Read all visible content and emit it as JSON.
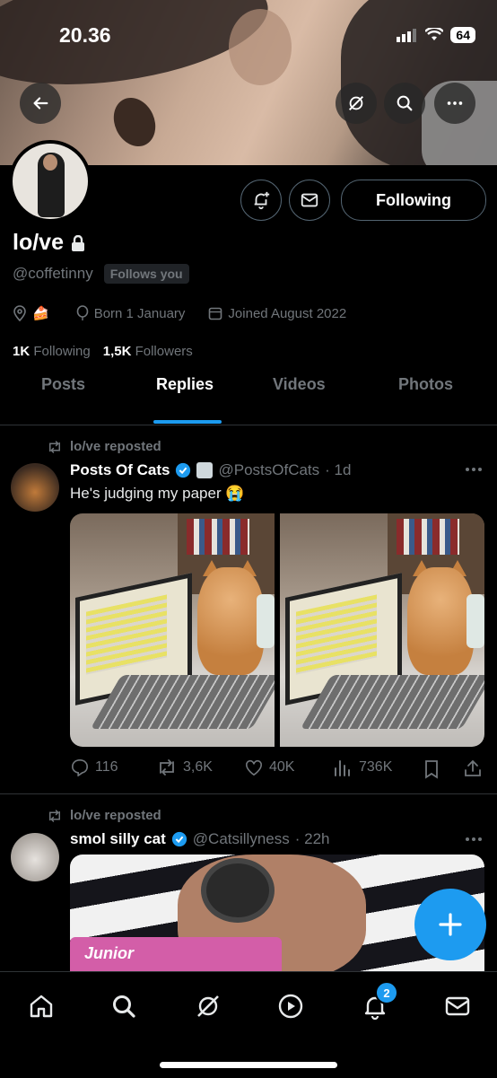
{
  "status_bar": {
    "time": "20.36",
    "battery": "64"
  },
  "profile": {
    "display_name": "lo/ve",
    "handle": "@coffetinny",
    "follows_you": "Follows you",
    "location_emoji": "🍰",
    "born": "Born 1 January",
    "joined": "Joined August 2022",
    "following_count": "1K",
    "following_label": "Following",
    "followers_count": "1,5K",
    "followers_label": "Followers",
    "follow_button": "Following"
  },
  "tabs": [
    {
      "label": "Posts"
    },
    {
      "label": "Replies"
    },
    {
      "label": "Videos"
    },
    {
      "label": "Photos"
    }
  ],
  "active_tab": "Replies",
  "posts": [
    {
      "repost_label": "lo/ve reposted",
      "author": "Posts Of Cats",
      "handle": "@PostsOfCats",
      "time": "· 1d",
      "text": "He's judging my paper 😭",
      "replies": "116",
      "reposts": "3,6K",
      "likes": "40K",
      "views": "736K"
    },
    {
      "repost_label": "lo/ve reposted",
      "author": "smol silly cat",
      "handle": "@Catsillyness",
      "time": "· 22h",
      "media_text": "Junior"
    }
  ],
  "nav": {
    "notifications_badge": "2"
  },
  "colors": {
    "accent": "#1d9bf0",
    "background": "#000000",
    "secondary_text": "#71767b"
  }
}
